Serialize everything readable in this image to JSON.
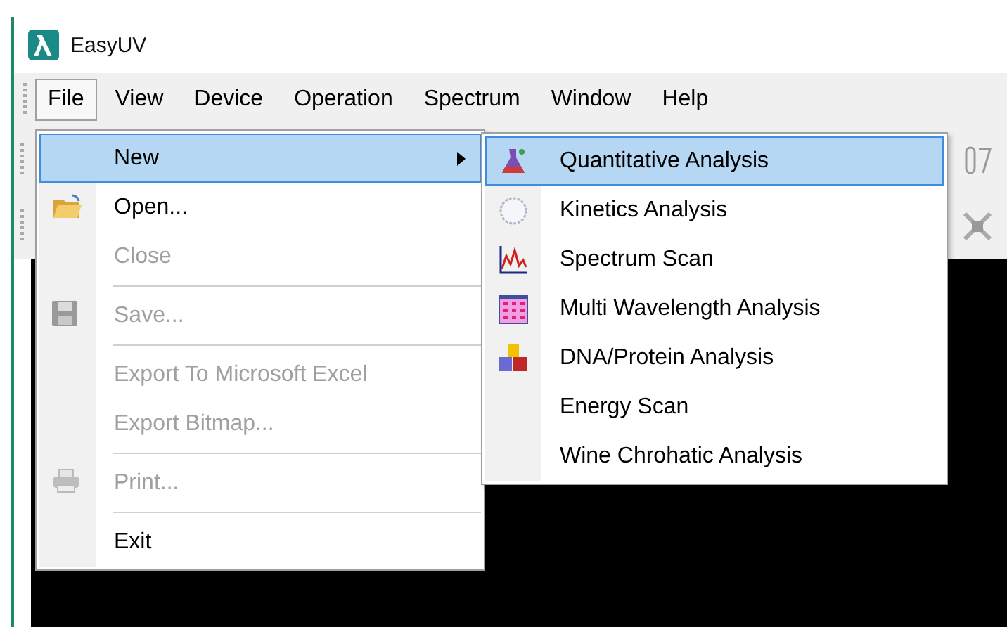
{
  "window": {
    "title": "EasyUV"
  },
  "menu_bar": [
    {
      "label": "File",
      "selected": true
    },
    {
      "label": "View",
      "selected": false
    },
    {
      "label": "Device",
      "selected": false
    },
    {
      "label": "Operation",
      "selected": false
    },
    {
      "label": "Spectrum",
      "selected": false
    },
    {
      "label": "Window",
      "selected": false
    },
    {
      "label": "Help",
      "selected": false
    }
  ],
  "file_menu": [
    {
      "kind": "item",
      "label": "New",
      "selected": true,
      "disabled": false,
      "submenu": true
    },
    {
      "kind": "item",
      "label": "Open...",
      "selected": false,
      "disabled": false,
      "submenu": false
    },
    {
      "kind": "item",
      "label": "Close",
      "selected": false,
      "disabled": true,
      "submenu": false
    },
    {
      "kind": "separator"
    },
    {
      "kind": "item",
      "label": "Save...",
      "selected": false,
      "disabled": true,
      "submenu": false
    },
    {
      "kind": "separator"
    },
    {
      "kind": "item",
      "label": "Export To Microsoft Excel",
      "selected": false,
      "disabled": true,
      "submenu": false
    },
    {
      "kind": "item",
      "label": "Export Bitmap...",
      "selected": false,
      "disabled": true,
      "submenu": false
    },
    {
      "kind": "separator"
    },
    {
      "kind": "item",
      "label": "Print...",
      "selected": false,
      "disabled": true,
      "submenu": false
    },
    {
      "kind": "separator"
    },
    {
      "kind": "item",
      "label": "Exit",
      "selected": false,
      "disabled": false,
      "submenu": false
    }
  ],
  "new_submenu": [
    {
      "label": "Quantitative Analysis",
      "selected": true
    },
    {
      "label": "Kinetics Analysis",
      "selected": false
    },
    {
      "label": "Spectrum Scan",
      "selected": false
    },
    {
      "label": "Multi Wavelength Analysis",
      "selected": false
    },
    {
      "label": "DNA/Protein Analysis",
      "selected": false
    },
    {
      "label": "Energy Scan",
      "selected": false
    },
    {
      "label": "Wine Chrohatic Analysis",
      "selected": false
    }
  ]
}
